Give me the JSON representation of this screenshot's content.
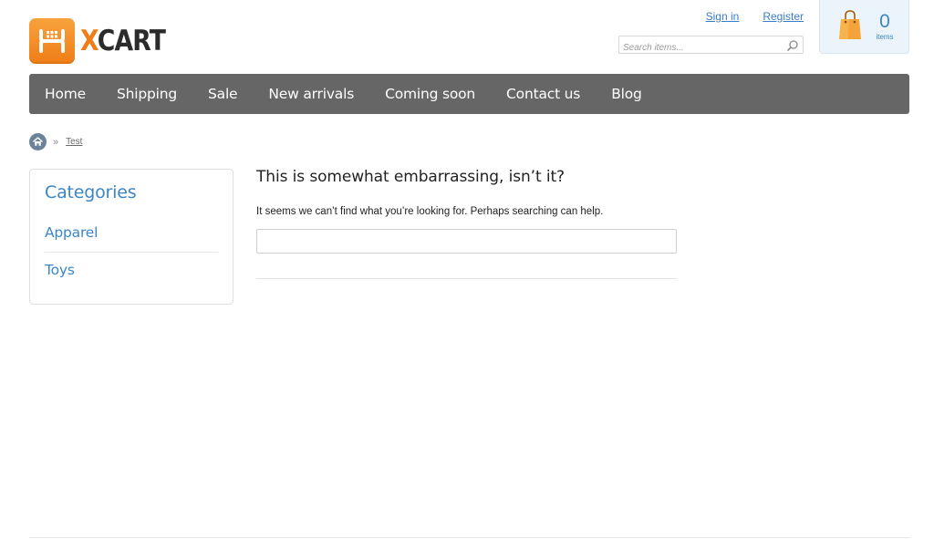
{
  "brand": {
    "logo_x": "X",
    "logo_rest": "CART",
    "accent_color": "#f07d18"
  },
  "header": {
    "sign_in_label": "Sign in",
    "register_label": "Register",
    "search_placeholder": "Search items...",
    "cart": {
      "count": "0",
      "label": "items"
    }
  },
  "nav": {
    "items": [
      {
        "label": "Home"
      },
      {
        "label": "Shipping"
      },
      {
        "label": "Sale"
      },
      {
        "label": "New arrivals"
      },
      {
        "label": "Coming soon"
      },
      {
        "label": "Contact us"
      },
      {
        "label": "Blog"
      }
    ]
  },
  "breadcrumb": {
    "separator": "»",
    "current": "Test"
  },
  "sidebar": {
    "title": "Categories",
    "items": [
      {
        "label": "Apparel"
      },
      {
        "label": "Toys"
      }
    ]
  },
  "main": {
    "heading": "This is somewhat embarrassing, isn’t it?",
    "message": "It seems we can’t find what you’re looking for. Perhaps searching can help.",
    "search_value": ""
  },
  "icons": {
    "logo": "xcart-logo-icon",
    "search": "magnifier-icon",
    "cart": "shopping-bag-icon",
    "home": "home-icon"
  },
  "colors": {
    "nav_background": "#666666",
    "link": "#3b86c6",
    "cart_background": "#ecf4fb"
  }
}
